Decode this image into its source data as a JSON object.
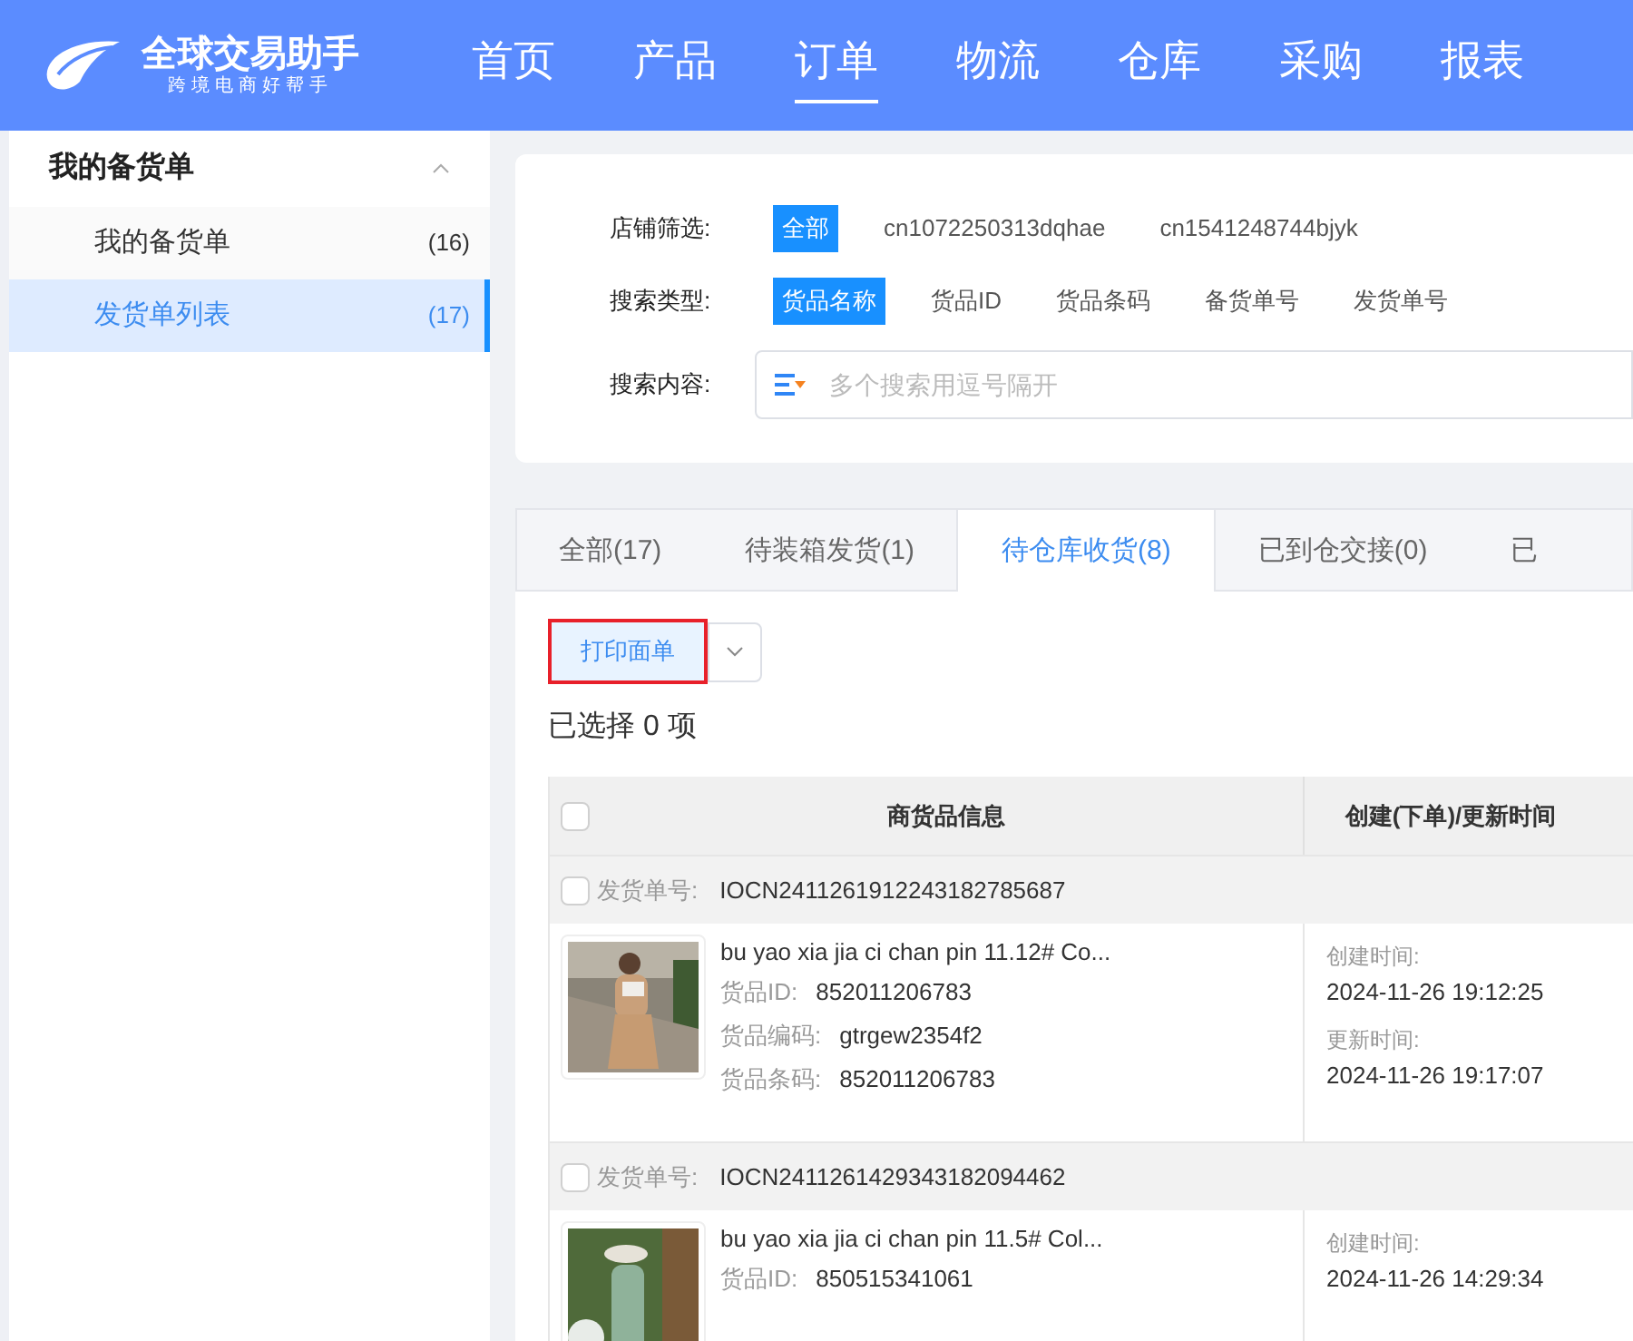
{
  "app": {
    "name": "全球交易助手",
    "slogan": "跨境电商好帮手"
  },
  "nav": [
    {
      "label": "首页",
      "selected": false
    },
    {
      "label": "产品",
      "selected": false
    },
    {
      "label": "订单",
      "selected": true
    },
    {
      "label": "物流",
      "selected": false
    },
    {
      "label": "仓库",
      "selected": false
    },
    {
      "label": "采购",
      "selected": false
    },
    {
      "label": "报表",
      "selected": false
    }
  ],
  "sidebar": {
    "group": {
      "label": "我的备货单",
      "expanded": true
    },
    "items": [
      {
        "label": "我的备货单",
        "count": "(16)",
        "selected": false
      },
      {
        "label": "发货单列表",
        "count": "(17)",
        "selected": true
      }
    ]
  },
  "filters": [
    {
      "label": "店铺筛选:",
      "options": [
        {
          "label": "全部",
          "selected": true
        },
        {
          "label": "cn1072250313dqhae",
          "selected": false
        },
        {
          "label": "cn1541248744bjyk",
          "selected": false
        }
      ]
    },
    {
      "label": "搜索类型:",
      "options": [
        {
          "label": "货品名称",
          "selected": true
        },
        {
          "label": "货品ID",
          "selected": false
        },
        {
          "label": "货品条码",
          "selected": false
        },
        {
          "label": "备货单号",
          "selected": false
        },
        {
          "label": "发货单号",
          "selected": false
        }
      ]
    }
  ],
  "search": {
    "label": "搜索内容:",
    "placeholder": "多个搜索用逗号隔开"
  },
  "tabs": [
    {
      "label": "全部(17)",
      "selected": false
    },
    {
      "label": "待装箱发货(1)",
      "selected": false
    },
    {
      "label": "待仓库收货(8)",
      "selected": true
    },
    {
      "label": "已到仓交接(0)",
      "selected": false
    },
    {
      "label": "已",
      "selected": false
    }
  ],
  "print_button": "打印面单",
  "selection_summary": "已选择 0 项",
  "table": {
    "columns": [
      "商货品信息",
      "创建(下单)/更新时间"
    ],
    "header_checked": false,
    "groups": [
      {
        "label": "发货单号:",
        "number": "IOCN2411261912243182785687",
        "checked": false,
        "title": "bu yao xia jia ci chan pin 11.12# Co...",
        "fields": [
          {
            "label": "货品ID:",
            "value": "852011206783"
          },
          {
            "label": "货品编码:",
            "value": "gtrgew2354f2"
          },
          {
            "label": "货品条码:",
            "value": "852011206783"
          }
        ],
        "times": [
          {
            "label": "创建时间:",
            "value": "2024-11-26 19:12:25"
          },
          {
            "label": "更新时间:",
            "value": "2024-11-26 19:17:07"
          }
        ]
      },
      {
        "label": "发货单号:",
        "number": "IOCN2411261429343182094462",
        "checked": false,
        "title": "bu yao xia jia ci chan pin 11.5# Col...",
        "fields": [
          {
            "label": "货品ID:",
            "value": "850515341061"
          }
        ],
        "times": [
          {
            "label": "创建时间:",
            "value": "2024-11-26 14:29:34"
          }
        ]
      }
    ]
  }
}
